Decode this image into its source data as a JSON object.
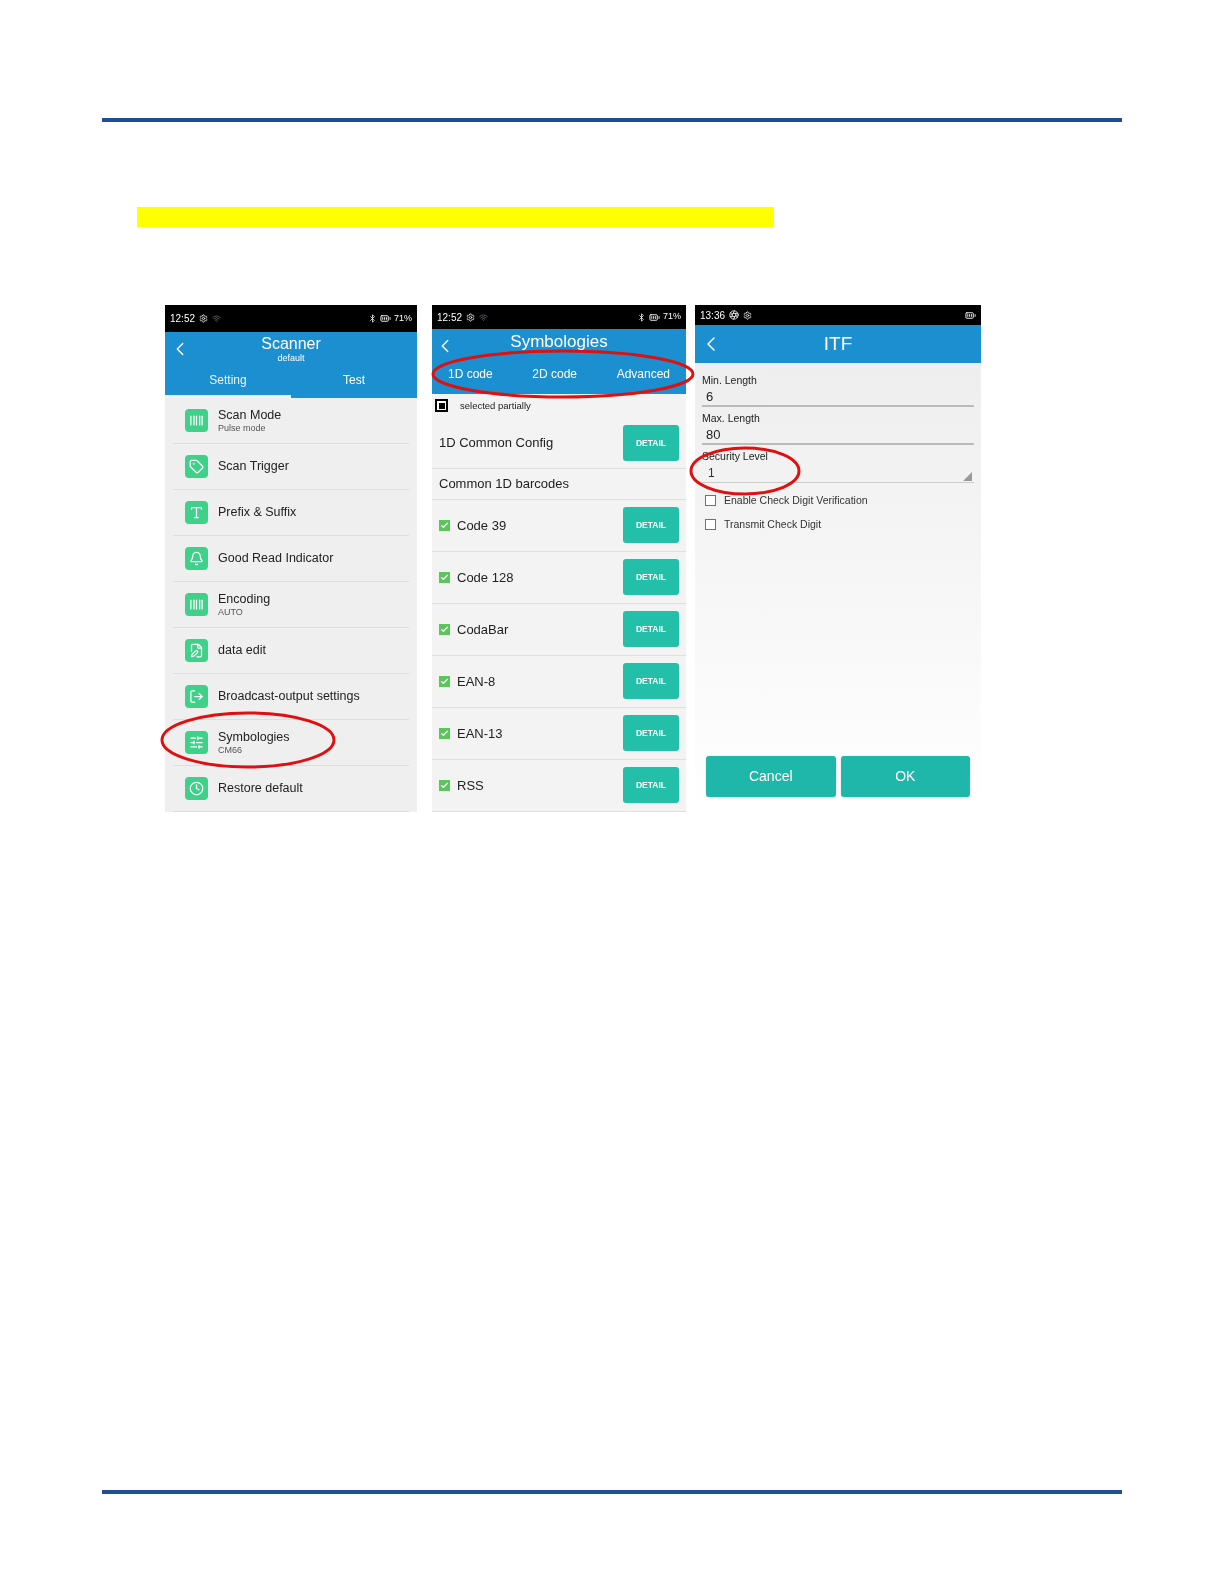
{
  "scanner_screen": {
    "status": {
      "time": "12:52",
      "battery": "71%"
    },
    "title": "Scanner",
    "subtitle": "default",
    "tabs": [
      {
        "label": "Setting",
        "selected": true
      },
      {
        "label": "Test",
        "selected": false
      }
    ],
    "items": [
      {
        "title": "Scan Mode",
        "subtitle": "Pulse mode"
      },
      {
        "title": "Scan Trigger"
      },
      {
        "title": "Prefix & Suffix"
      },
      {
        "title": "Good Read Indicator"
      },
      {
        "title": "Encoding",
        "subtitle": "AUTO"
      },
      {
        "title": "data edit"
      },
      {
        "title": "Broadcast-output settings"
      },
      {
        "title": "Symbologies",
        "subtitle": "CM66"
      },
      {
        "title": "Restore default"
      }
    ]
  },
  "symbologies_screen": {
    "status": {
      "time": "12:52",
      "battery": "71%"
    },
    "title": "Symbologies",
    "tabs": [
      {
        "label": "1D code"
      },
      {
        "label": "2D code"
      },
      {
        "label": "Advanced"
      }
    ],
    "select_all": {
      "label": "selected partially",
      "partial": true
    },
    "rows": [
      {
        "kind": "config",
        "label": "1D Common Config",
        "button": "DETAIL"
      },
      {
        "kind": "header",
        "label": "Common 1D barcodes"
      },
      {
        "kind": "barcode",
        "label": "Code 39",
        "checked": true,
        "button": "DETAIL"
      },
      {
        "kind": "barcode",
        "label": "Code 128",
        "checked": true,
        "button": "DETAIL"
      },
      {
        "kind": "barcode",
        "label": "CodaBar",
        "checked": true,
        "button": "DETAIL"
      },
      {
        "kind": "barcode",
        "label": "EAN-8",
        "checked": true,
        "button": "DETAIL"
      },
      {
        "kind": "barcode",
        "label": "EAN-13",
        "checked": true,
        "button": "DETAIL"
      },
      {
        "kind": "barcode",
        "label": "RSS",
        "checked": true,
        "button": "DETAIL"
      }
    ]
  },
  "itf_screen": {
    "status": {
      "time": "13:36"
    },
    "title": "ITF",
    "fields": [
      {
        "kind": "text",
        "label": "Min. Length",
        "value": "6"
      },
      {
        "kind": "text",
        "label": "Max. Length",
        "value": "80"
      },
      {
        "kind": "dropdown",
        "label": "Security Level",
        "value": "1"
      }
    ],
    "checkboxes": [
      {
        "label": "Enable Check Digit Verification",
        "checked": false
      },
      {
        "label": "Transmit Check Digit",
        "checked": false
      }
    ],
    "buttons": [
      "Cancel",
      "OK"
    ]
  }
}
